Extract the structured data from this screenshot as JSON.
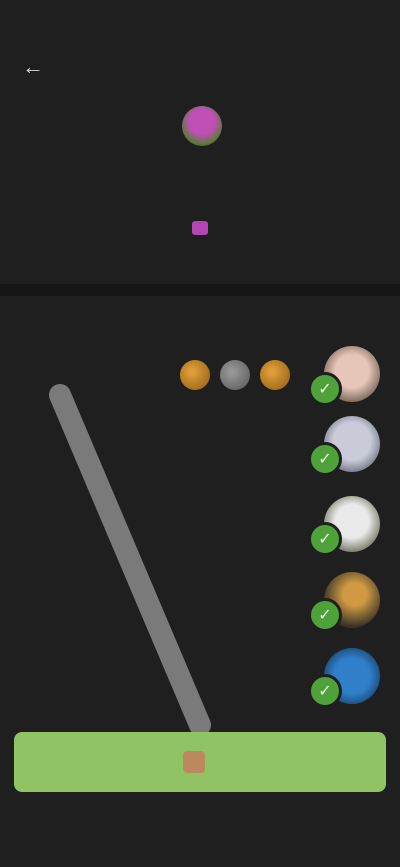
{
  "status_bar": {
    "time": "",
    "indicators": ""
  },
  "header": {
    "back_icon": "arrow-left-icon",
    "title": ""
  },
  "profile": {
    "name": "",
    "description": ""
  },
  "feed": {
    "left_label": "",
    "right_label": ""
  },
  "rows": [
    {
      "label": "",
      "badge": "✓"
    },
    {
      "label": "",
      "badge": "✓"
    },
    {
      "label": "",
      "badge": "✓"
    },
    {
      "label": "",
      "badge": "✓"
    },
    {
      "label": "",
      "badge": "✓"
    }
  ],
  "action_button": {
    "label": ""
  },
  "bottom_nav": {
    "items": [
      "",
      "",
      ""
    ]
  },
  "colors": {
    "accent_green": "#8fc363",
    "badge_green": "#4fa23a",
    "gem_purple": "#b545b5",
    "coin_gold": "#e6a33a"
  }
}
